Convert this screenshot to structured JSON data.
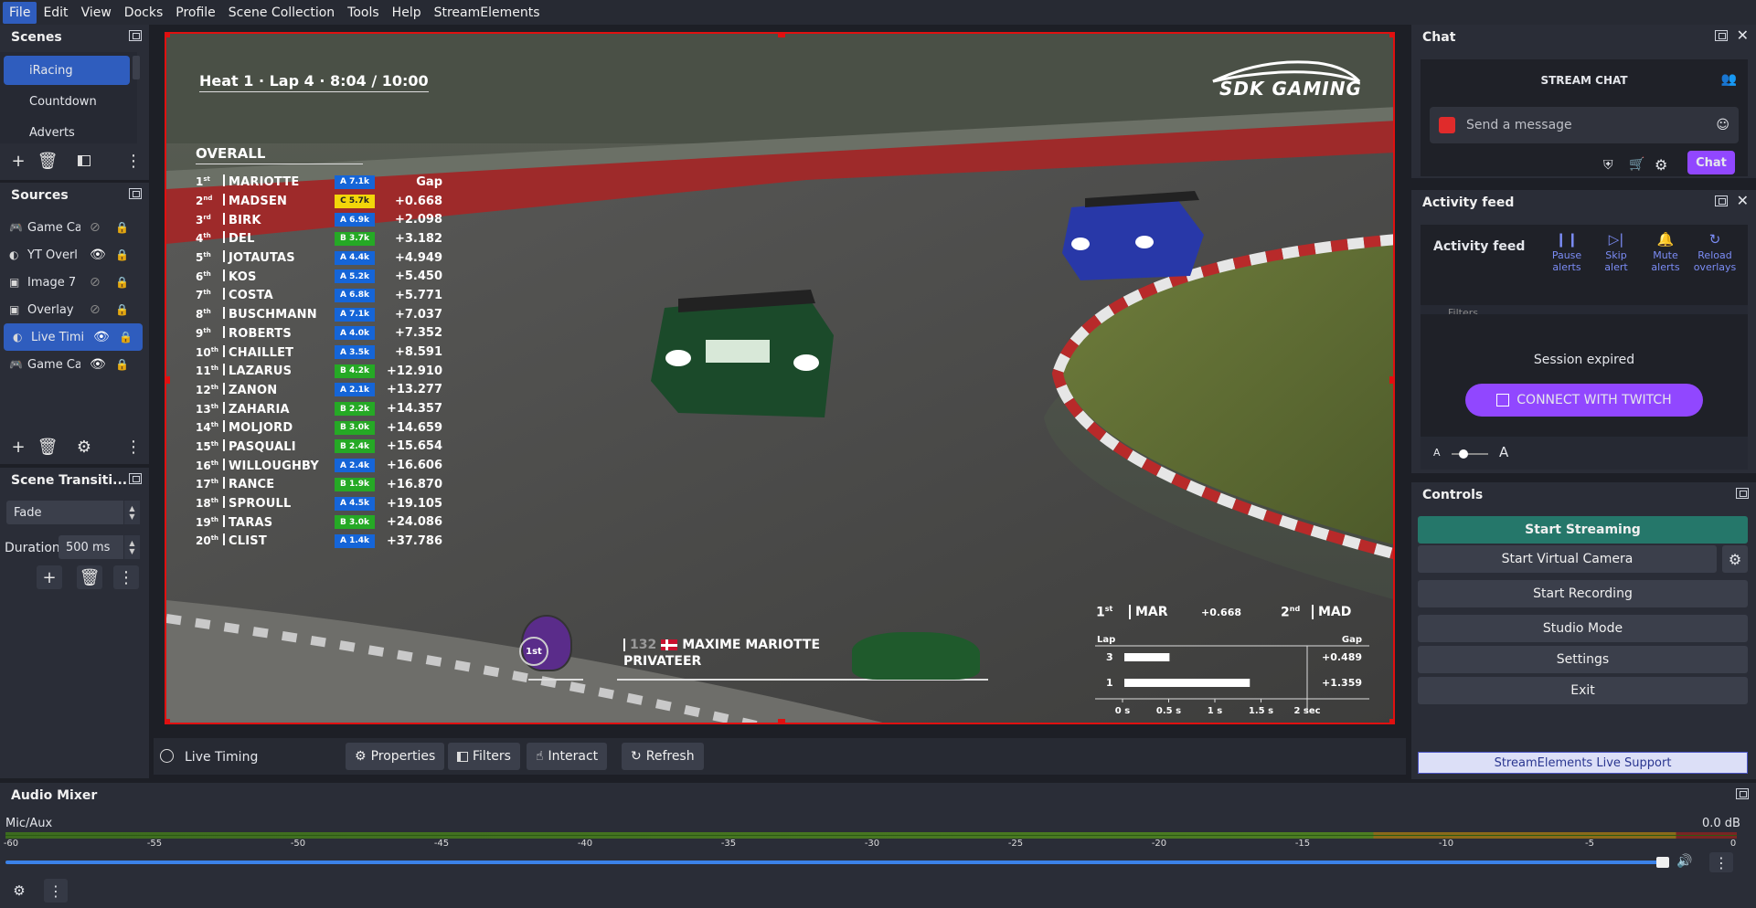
{
  "menu": [
    "File",
    "Edit",
    "View",
    "Docks",
    "Profile",
    "Scene Collection",
    "Tools",
    "Help",
    "StreamElements"
  ],
  "scenes": {
    "title": "Scenes",
    "items": [
      "iRacing",
      "Countdown",
      "Adverts"
    ],
    "selected": 0
  },
  "sources": {
    "title": "Sources",
    "items": [
      {
        "name": "Game Ca",
        "visible": false,
        "type": "gamepad"
      },
      {
        "name": "YT Overl",
        "visible": true,
        "type": "browser"
      },
      {
        "name": "Image 7",
        "visible": false,
        "type": "image"
      },
      {
        "name": "Overlay",
        "visible": false,
        "type": "image"
      },
      {
        "name": "Live Timi",
        "visible": true,
        "type": "browser",
        "selected": true
      },
      {
        "name": "Game Ca",
        "visible": true,
        "type": "gamepad"
      }
    ]
  },
  "transitions": {
    "title": "Scene Transiti...",
    "type": "Fade",
    "duration_label": "Duration",
    "duration": "500 ms"
  },
  "preview": {
    "heat": "Heat 1 · Lap 4 · 8:04 / 10:00",
    "brand": "SDK GAMING",
    "overall": "OVERALL",
    "gap_header": "Gap",
    "standings": [
      {
        "pos": "1",
        "sfx": "st",
        "name": "MARIOTTE",
        "cls": "A 7.1k",
        "col": "#1565d8",
        "gap": "Gap"
      },
      {
        "pos": "2",
        "sfx": "nd",
        "name": "MADSEN",
        "cls": "C 5.7k",
        "col": "#f2d60a",
        "gap": "+0.668"
      },
      {
        "pos": "3",
        "sfx": "rd",
        "name": "BIRK",
        "cls": "A 6.9k",
        "col": "#1565d8",
        "gap": "+2.098"
      },
      {
        "pos": "4",
        "sfx": "th",
        "name": "DEL",
        "cls": "B 3.7k",
        "col": "#25a925",
        "gap": "+3.182"
      },
      {
        "pos": "5",
        "sfx": "th",
        "name": "JOTAUTAS",
        "cls": "A 4.4k",
        "col": "#1565d8",
        "gap": "+4.949"
      },
      {
        "pos": "6",
        "sfx": "th",
        "name": "KOS",
        "cls": "A 5.2k",
        "col": "#1565d8",
        "gap": "+5.450"
      },
      {
        "pos": "7",
        "sfx": "th",
        "name": "COSTA",
        "cls": "A 6.8k",
        "col": "#1565d8",
        "gap": "+5.771"
      },
      {
        "pos": "8",
        "sfx": "th",
        "name": "BUSCHMANN",
        "cls": "A 7.1k",
        "col": "#1565d8",
        "gap": "+7.037"
      },
      {
        "pos": "9",
        "sfx": "th",
        "name": "ROBERTS",
        "cls": "A 4.0k",
        "col": "#1565d8",
        "gap": "+7.352"
      },
      {
        "pos": "10",
        "sfx": "th",
        "name": "CHAILLET",
        "cls": "A 3.5k",
        "col": "#1565d8",
        "gap": "+8.591"
      },
      {
        "pos": "11",
        "sfx": "th",
        "name": "LAZARUS",
        "cls": "B 4.2k",
        "col": "#25a925",
        "gap": "+12.910"
      },
      {
        "pos": "12",
        "sfx": "th",
        "name": "ZANON",
        "cls": "A 2.1k",
        "col": "#1565d8",
        "gap": "+13.277"
      },
      {
        "pos": "13",
        "sfx": "th",
        "name": "ZAHARIA",
        "cls": "B 2.2k",
        "col": "#25a925",
        "gap": "+14.357"
      },
      {
        "pos": "14",
        "sfx": "th",
        "name": "MOLJORD",
        "cls": "B 3.0k",
        "col": "#25a925",
        "gap": "+14.659"
      },
      {
        "pos": "15",
        "sfx": "th",
        "name": "PASQUALI",
        "cls": "B 2.4k",
        "col": "#25a925",
        "gap": "+15.654"
      },
      {
        "pos": "16",
        "sfx": "th",
        "name": "WILLOUGHBY",
        "cls": "A 2.4k",
        "col": "#1565d8",
        "gap": "+16.606"
      },
      {
        "pos": "17",
        "sfx": "th",
        "name": "RANCE",
        "cls": "B 1.9k",
        "col": "#25a925",
        "gap": "+16.870"
      },
      {
        "pos": "18",
        "sfx": "th",
        "name": "SPROULL",
        "cls": "A 4.5k",
        "col": "#1565d8",
        "gap": "+19.105"
      },
      {
        "pos": "19",
        "sfx": "th",
        "name": "TARAS",
        "cls": "B 3.0k",
        "col": "#25a925",
        "gap": "+24.086"
      },
      {
        "pos": "20",
        "sfx": "th",
        "name": "CLIST",
        "cls": "A 1.4k",
        "col": "#1565d8",
        "gap": "+37.786"
      }
    ],
    "driver": {
      "number": "132",
      "name": "MAXIME MARIOTTE",
      "team": "PRIVATEER",
      "position": "1st"
    },
    "battle": {
      "p1": "1",
      "p1_sfx": "st",
      "p1_name": "MAR",
      "gap": "+0.668",
      "p2": "2",
      "p2_sfx": "nd",
      "p2_name": "MAD",
      "lap_header": "Lap",
      "gap_header": "Gap"
    }
  },
  "chart_data": {
    "type": "bar",
    "categories": [
      "3",
      "1"
    ],
    "values": [
      0.489,
      1.359
    ],
    "labels": [
      "+0.489",
      "+1.359"
    ],
    "xlabel": "",
    "ylabel": "Lap",
    "xticks": [
      "0 s",
      "0.5 s",
      "1 s",
      "1.5 s",
      "2 sec"
    ],
    "xlim": [
      0,
      2
    ]
  },
  "preview_toolbar": {
    "source": "Live Timing",
    "properties": "Properties",
    "filters": "Filters",
    "interact": "Interact",
    "refresh": "Refresh"
  },
  "chat": {
    "title": "Chat",
    "header": "STREAM CHAT",
    "placeholder": "Send a message",
    "button": "Chat"
  },
  "activity": {
    "title": "Activity feed",
    "label": "Activity feed",
    "actions": [
      "Pause alerts",
      "Skip alert",
      "Mute alerts",
      "Reload overlays"
    ],
    "filter": "Filters",
    "expired": "Session expired",
    "connect": "CONNECT WITH TWITCH",
    "font_small": "A",
    "font_large": "A"
  },
  "controls": {
    "title": "Controls",
    "buttons": [
      "Start Streaming",
      "Start Virtual Camera",
      "Start Recording",
      "Studio Mode",
      "Settings",
      "Exit"
    ],
    "support": "StreamElements Live Support"
  },
  "mixer": {
    "title": "Audio Mixer",
    "channel": "Mic/Aux",
    "level": "0.0 dB",
    "ticks": [
      "-60",
      "-55",
      "-50",
      "-45",
      "-40",
      "-35",
      "-30",
      "-25",
      "-20",
      "-15",
      "-10",
      "-5",
      "0"
    ]
  }
}
